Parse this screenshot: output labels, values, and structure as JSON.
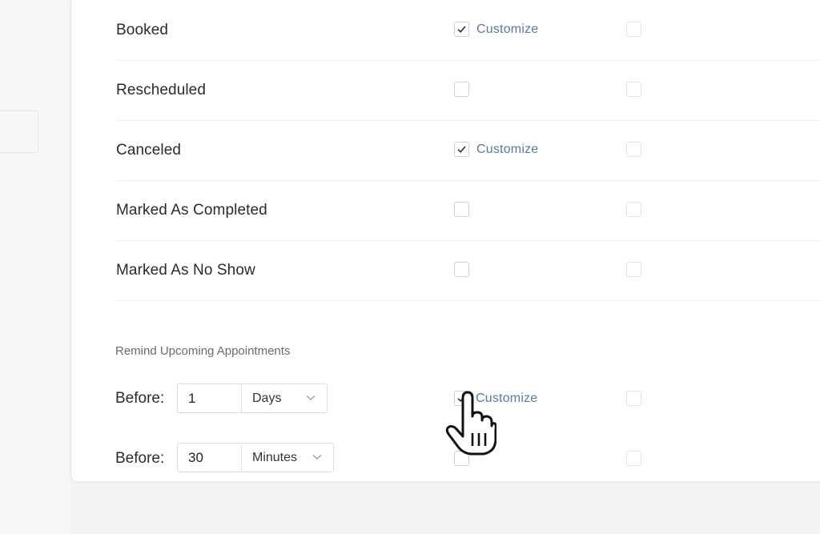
{
  "notifications": [
    {
      "label": "Booked",
      "customer_checked": true,
      "customize": "Customize"
    },
    {
      "label": "Rescheduled",
      "customer_checked": false,
      "customize": ""
    },
    {
      "label": "Canceled",
      "customer_checked": true,
      "customize": "Customize"
    },
    {
      "label": "Marked As Completed",
      "customer_checked": false,
      "customize": ""
    },
    {
      "label": "Marked As No Show",
      "customer_checked": false,
      "customize": ""
    }
  ],
  "reminders": {
    "title": "Remind Upcoming Appointments",
    "items": [
      {
        "label": "Before:",
        "value": "1",
        "unit": "Days",
        "customer_checked": true,
        "customize": "Customize"
      },
      {
        "label": "Before:",
        "value": "30",
        "unit": "Minutes",
        "customer_checked": false,
        "customize": ""
      }
    ]
  },
  "icons": {
    "check": "check-icon",
    "chevron": "chevron-down-icon",
    "cursor": "hand-pointer-icon"
  },
  "colors": {
    "link": "#5a7aa0",
    "text": "#2b2b2b",
    "muted": "#6b6b6b"
  }
}
